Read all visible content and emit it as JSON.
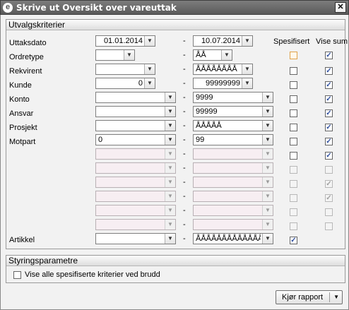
{
  "window": {
    "title": "Skrive ut Oversikt over vareuttak",
    "close_glyph": "✕",
    "app_icon": "e"
  },
  "groups": {
    "criteria_title": "Utvalgskriterier",
    "steering_title": "Styringsparametre"
  },
  "columns": {
    "spesifisert": "Spesifisert",
    "vise_sum": "Vise sum"
  },
  "separator": "-",
  "rows": [
    {
      "label": "Uttaksdato",
      "from": "01.01.2014",
      "to": "10.07.2014",
      "spec": false,
      "sum": true
    },
    {
      "label": "Ordretype",
      "from": "",
      "to": "ÅÅ",
      "spec": false,
      "sum": true
    },
    {
      "label": "Rekvirent",
      "from": "",
      "to": "ÅÅÅÅÅÅÅÅ",
      "spec": false,
      "sum": true
    },
    {
      "label": "Kunde",
      "from": "0",
      "to": "99999999",
      "spec": false,
      "sum": true
    },
    {
      "label": "Konto",
      "from": "",
      "to": "9999",
      "spec": false,
      "sum": true
    },
    {
      "label": "Ansvar",
      "from": "",
      "to": "99999",
      "spec": false,
      "sum": true
    },
    {
      "label": "Prosjekt",
      "from": "",
      "to": "ÅÅÅÅÅ",
      "spec": false,
      "sum": true
    },
    {
      "label": "Motpart",
      "from": "0",
      "to": "99",
      "spec": false,
      "sum": true
    },
    {
      "label": "Artikkel",
      "from": "",
      "to": "ÅÅÅÅÅÅÅÅÅÅÅÅÅÅÅÅ",
      "spec": true
    }
  ],
  "check_glyph": "✓",
  "dropdown_glyph": "▼",
  "steering": {
    "checkbox_label": "Vise alle spesifiserte kriterier ved brudd",
    "checked": false
  },
  "footer": {
    "run_button": "Kjør rapport"
  }
}
